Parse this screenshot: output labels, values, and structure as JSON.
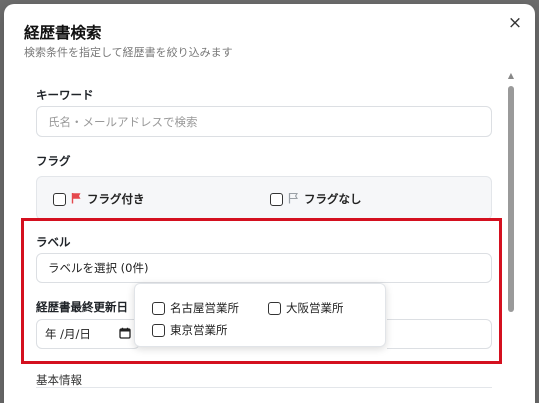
{
  "dialog": {
    "title": "経歴書検索",
    "subtitle": "検索条件を指定して経歴書を絞り込みます",
    "close_icon": "×"
  },
  "keyword": {
    "label": "キーワード",
    "placeholder": "氏名・メールアドレスで検索"
  },
  "flag": {
    "label": "フラグ",
    "with_flag": "フラグ付き",
    "without_flag": "フラグなし",
    "with_flag_color": "#e5484d",
    "without_flag_color": "#9aa0a6"
  },
  "label_field": {
    "label": "ラベル",
    "select_text": "ラベルを選択 (0件)"
  },
  "updated_date": {
    "label": "経歴書最終更新日",
    "date_placeholder": "年 /月/日"
  },
  "label_options": [
    "名古屋営業所",
    "大阪営業所",
    "東京営業所"
  ],
  "basic_info": {
    "label": "基本情報"
  },
  "colors": {
    "highlight": "#d4101f"
  }
}
